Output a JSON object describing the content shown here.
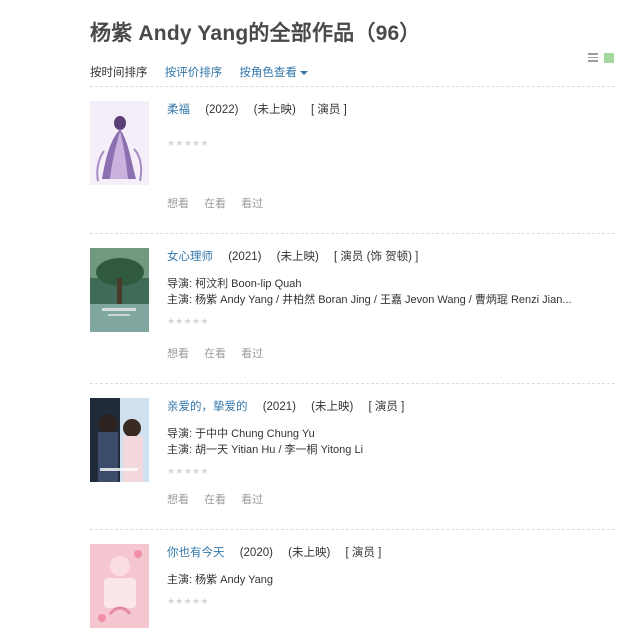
{
  "page_title": "杨紫 Andy Yang的全部作品（96）",
  "sort": {
    "by_time": "按时间排序",
    "by_rating": "按评价排序",
    "by_role": "按角色查看"
  },
  "actions": {
    "want": "想看",
    "watching": "在看",
    "watched": "看过"
  },
  "rating_stars": "★★★★★",
  "works": [
    {
      "title": "柔福",
      "year": "(2022)",
      "status": "(未上映)",
      "role": "[ 演员 ]",
      "director": "",
      "cast": ""
    },
    {
      "title": "女心理师",
      "year": "(2021)",
      "status": "(未上映)",
      "role": "[ 演员 (饰 贺顿) ]",
      "director": "导演: 柯汶利 Boon-lip Quah",
      "cast": "主演: 杨紫 Andy Yang / 井柏然 Boran Jing / 王嘉 Jevon Wang / 曹炳琨 Renzi Jian..."
    },
    {
      "title": "亲爱的，挚爱的",
      "year": "(2021)",
      "status": "(未上映)",
      "role": "[ 演员 ]",
      "director": "导演: 于中中 Chung Chung Yu",
      "cast": "主演: 胡一天 Yitian Hu / 李一桐 Yitong Li"
    },
    {
      "title": "你也有今天",
      "year": "(2020)",
      "status": "(未上映)",
      "role": "[ 演员 ]",
      "director": "",
      "cast": "主演: 杨紫 Andy Yang"
    }
  ]
}
